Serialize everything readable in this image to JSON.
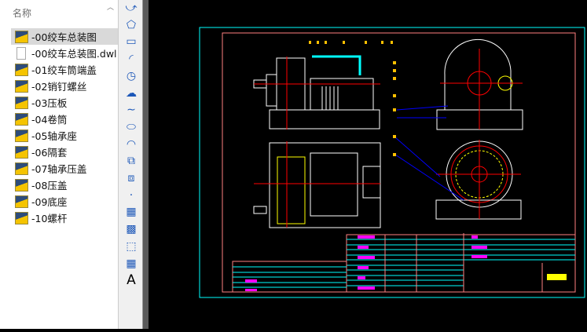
{
  "file_panel": {
    "column_header": "名称",
    "items": [
      {
        "label": "-00绞车总装图",
        "type": "dwg",
        "selected": true
      },
      {
        "label": "-00绞车总装图.dwl",
        "type": "file",
        "selected": false
      },
      {
        "label": "-01绞车筒端盖",
        "type": "dwg",
        "selected": false
      },
      {
        "label": "-02销钉螺丝",
        "type": "dwg",
        "selected": false
      },
      {
        "label": "-03压板",
        "type": "dwg",
        "selected": false
      },
      {
        "label": "-04卷筒",
        "type": "dwg",
        "selected": false
      },
      {
        "label": "-05轴承座",
        "type": "dwg",
        "selected": false
      },
      {
        "label": "-06隔套",
        "type": "dwg",
        "selected": false
      },
      {
        "label": "-07轴承压盖",
        "type": "dwg",
        "selected": false
      },
      {
        "label": "-08压盖",
        "type": "dwg",
        "selected": false
      },
      {
        "label": "-09底座",
        "type": "dwg",
        "selected": false
      },
      {
        "label": "-10螺杆",
        "type": "dwg",
        "selected": false
      }
    ]
  },
  "draw_toolbar": {
    "tools": [
      "polyline-icon",
      "polygon-icon",
      "rectangle-icon",
      "arc-icon",
      "circle-icon",
      "revision-cloud-icon",
      "spline-icon",
      "ellipse-icon",
      "ellipse-arc-icon",
      "insert-block-icon",
      "make-block-icon",
      "point-icon",
      "hatch-icon",
      "gradient-icon",
      "region-icon",
      "table-icon",
      "mtext-icon"
    ],
    "text_tool_label": "A"
  },
  "colors": {
    "canvas": "#000000",
    "frame_outer": "#00ffff",
    "frame_inner": "#ff8080",
    "geometry": "#ffffff",
    "centerline": "#ff0000",
    "accent_green": "#00ff00",
    "leader": "#0000ff",
    "label": "#ffc000",
    "table_text": "#ff00ff"
  }
}
